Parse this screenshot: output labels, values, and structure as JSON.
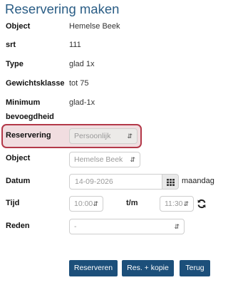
{
  "page": {
    "title": "Reservering maken"
  },
  "info": [
    {
      "label": "Object",
      "value": "Hemelse Beek"
    },
    {
      "label": "srt",
      "value": "111"
    },
    {
      "label": "Type",
      "value": "glad 1x"
    },
    {
      "label": "Gewichtsklasse",
      "value": "tot 75"
    },
    {
      "label": "Minimum",
      "label2": "bevoegdheid",
      "value": "glad-1x"
    }
  ],
  "form": {
    "reservering": {
      "label": "Reservering",
      "value": "Persoonlijk"
    },
    "object": {
      "label": "Object",
      "value": "Hemelse Beek"
    },
    "datum": {
      "label": "Datum",
      "value": "14-09-2026",
      "weekday": "maandag"
    },
    "tijd": {
      "label": "Tijd",
      "start": "10:00",
      "separator": "t/m",
      "end": "11:30"
    },
    "reden": {
      "label": "Reden",
      "value": "-"
    }
  },
  "buttons": {
    "reserveren": "Reserveren",
    "res_kopie": "Res. + kopie",
    "terug": "Terug"
  },
  "colors": {
    "title": "#2a5d85",
    "button": "#1c4f7a",
    "highlight_border": "#b33848",
    "highlight_fill": "#f1dde0"
  },
  "icons": {
    "calendar": "calendar-grid-icon",
    "sync": "refresh-icon",
    "select": "up-down-chevron-icon"
  }
}
